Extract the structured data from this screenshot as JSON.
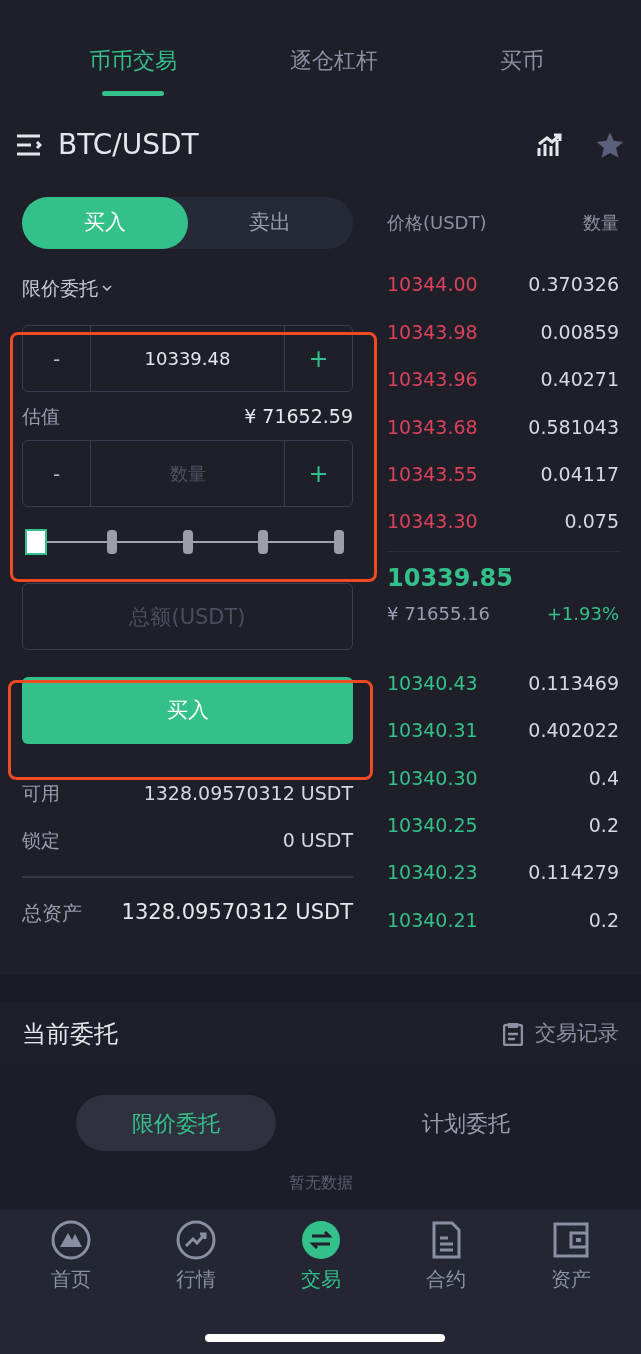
{
  "top_tabs": [
    {
      "label": "币币交易",
      "selected": true
    },
    {
      "label": "逐仓杠杆",
      "selected": false
    },
    {
      "label": "买币",
      "selected": false
    }
  ],
  "pair": "BTC/USDT",
  "side_tabs": [
    {
      "label": "买入",
      "selected": true
    },
    {
      "label": "卖出",
      "selected": false
    }
  ],
  "order_type": "限价委托",
  "price_field": {
    "minus": "-",
    "value": "10339.48",
    "plus": "+"
  },
  "estimate": {
    "label": "估值",
    "value": "¥ 71652.59"
  },
  "amount_field": {
    "minus": "-",
    "placeholder": "数量",
    "plus": "+"
  },
  "slider": {
    "level": 0
  },
  "total_field": {
    "placeholder": "总额(USDT)"
  },
  "buy_button": "买入",
  "balances": [
    {
      "label": "可用",
      "value": "1328.09570312 USDT"
    },
    {
      "label": "锁定",
      "value": "0 USDT"
    }
  ],
  "total_assets": {
    "label": "总资产",
    "value": "1328.09570312 USDT"
  },
  "orderbook": {
    "columns": [
      "价格(USDT)",
      "数量"
    ],
    "asks": [
      {
        "price": "10344.00",
        "amount": "0.370326"
      },
      {
        "price": "10343.98",
        "amount": "0.00859"
      },
      {
        "price": "10343.96",
        "amount": "0.40271"
      },
      {
        "price": "10343.68",
        "amount": "0.581043"
      },
      {
        "price": "10343.55",
        "amount": "0.04117"
      },
      {
        "price": "10343.30",
        "amount": "0.075"
      }
    ],
    "last_price": "10339.85",
    "last_cny": "¥ 71655.16",
    "change": "+1.93%",
    "bids": [
      {
        "price": "10340.43",
        "amount": "0.113469"
      },
      {
        "price": "10340.31",
        "amount": "0.402022"
      },
      {
        "price": "10340.30",
        "amount": "0.4"
      },
      {
        "price": "10340.25",
        "amount": "0.2"
      },
      {
        "price": "10340.23",
        "amount": "0.114279"
      },
      {
        "price": "10340.21",
        "amount": "0.2"
      }
    ]
  },
  "orders": {
    "title": "当前委托",
    "history": "交易记录",
    "tabs": [
      {
        "label": "限价委托",
        "selected": true
      },
      {
        "label": "计划委托",
        "selected": false
      }
    ],
    "empty": "暂无数据"
  },
  "nav": [
    {
      "label": "首页",
      "kind": "home",
      "selected": false
    },
    {
      "label": "行情",
      "kind": "market",
      "selected": false
    },
    {
      "label": "交易",
      "kind": "trade",
      "selected": true
    },
    {
      "label": "合约",
      "kind": "contract",
      "selected": false
    },
    {
      "label": "资产",
      "kind": "assets",
      "selected": false
    }
  ]
}
